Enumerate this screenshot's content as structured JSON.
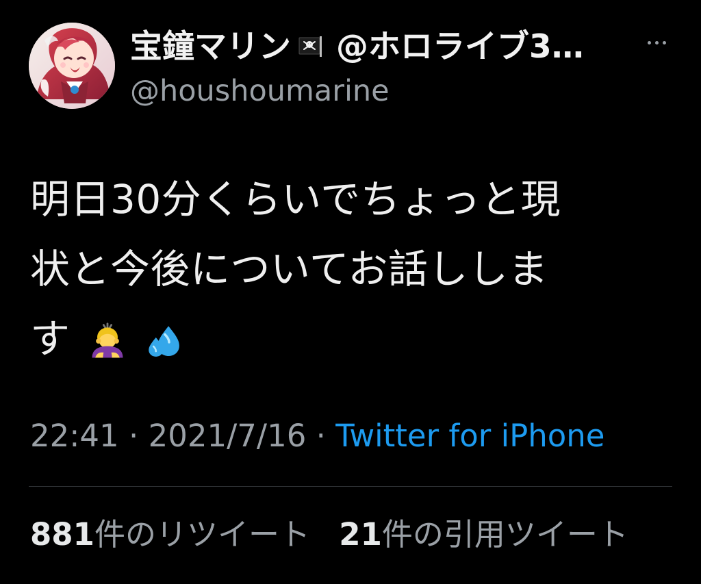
{
  "tweet": {
    "author": {
      "display_name": "宝鐘マリン",
      "display_name_suffix": "@ホロライブ3…",
      "handle": "@houshoumarine",
      "avatar_icon": "avatar-image",
      "flag_icon": "pirate-flag-icon",
      "more_icon": "more-horizontal-icon"
    },
    "body": {
      "lines": [
        "明日30分くらいでちょっと現",
        "状と今後についてお話ししま",
        "す"
      ],
      "emoji": [
        "person-bowing-emoji",
        "sweat-droplets-emoji"
      ]
    },
    "meta": {
      "time": "22:41",
      "separator": " · ",
      "date": "2021/7/16",
      "separator2": " · ",
      "source": "Twitter for iPhone"
    },
    "stats": {
      "retweets": {
        "count": "881",
        "label": "件のリツイート"
      },
      "quotes": {
        "count": "21",
        "label": "件の引用ツイート"
      }
    }
  },
  "colors": {
    "background": "#000000",
    "primary_text": "#e7e9ea",
    "secondary_text": "#9aa0a6",
    "link": "#1d9bf0",
    "divider": "#2f3336"
  }
}
